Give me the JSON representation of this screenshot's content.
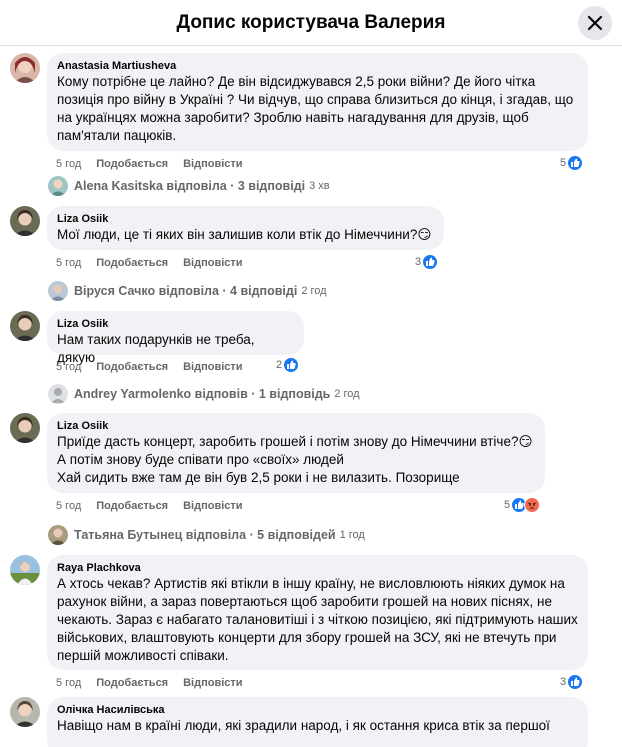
{
  "header": {
    "title": "Допис користувача Валерия"
  },
  "actions": {
    "like": "Подобається",
    "reply": "Відповісти"
  },
  "comments": [
    {
      "author": "Anastasia Martiusheva",
      "text": "Кому потрібне це лайно? Де він відсиджувався 2,5 роки війни? Де його чітка позиція про війну в Україні ? Чи відчув, що справа близиться до кінця, і згадав, що на українцях можна заробити? Зроблю навіть нагадування для друзів, щоб пам'ятали пацюків.",
      "time": "5 год",
      "reactions": "5",
      "replies": {
        "text": "Alena Kasitska відповіла · 3 відповіді",
        "time": "3 хв"
      }
    },
    {
      "author": "Liza Osiik",
      "text": "Мої люди, це ті яких він залишив коли втік до Німеччини?😏",
      "time": "5 год",
      "reactions": "3",
      "replies": {
        "text": "Віруся Сачко відповіла · 4 відповіді",
        "time": "2 год"
      }
    },
    {
      "author": "Liza Osiik",
      "text": "Нам таких подарунків не треба, дякую",
      "time": "5 год",
      "reactions": "2",
      "replies": {
        "text": "Andrey Yarmolenko відповів · 1 відповідь",
        "time": "2 год"
      }
    },
    {
      "author": "Liza Osiik",
      "text": "Приїде дасть концерт, заробить грошей і потім знову до Німеччини втіче?😏\nА потім знову буде співати про «своїх» людей\nХай сидить вже там де він був 2,5 роки і не вилазить. Позорище",
      "time": "5 год",
      "reactions": "5",
      "replies": {
        "text": "Татьяна Бутынец відповіла · 5 відповідей",
        "time": "1 год"
      }
    },
    {
      "author": "Raya Plachkova",
      "text": "А хтось чекав? Артистів які втікли в іншу країну, не висловлюють ніяких думок на рахунок війни, а зараз повертаються щоб заробити грошей на нових піснях, не чекають. Зараз є набагато талановитіші і з чіткою позицією, які підтримують наших військових, влаштовують концерти для збору грошей на ЗСУ, які не втечуть при першій можливості співаки.",
      "time": "5 год",
      "reactions": "3"
    },
    {
      "author": "Олічка Насилівська",
      "text": "Навіщо нам в країні люди, які зрадили народ, і як остання криса втік за першої"
    }
  ]
}
